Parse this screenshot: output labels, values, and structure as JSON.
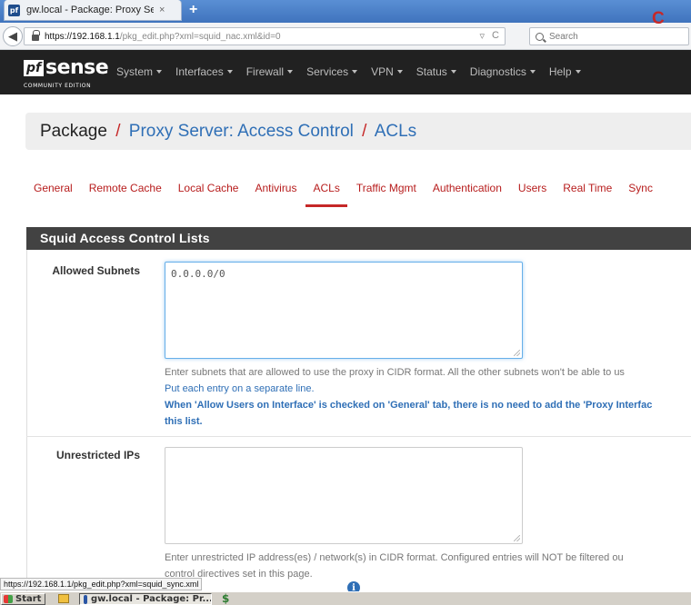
{
  "browser": {
    "tab_favicon": "pf",
    "tab_title": "gw.local - Package: Proxy Ser...",
    "tab_close": "×",
    "new_tab": "+",
    "url_host": "https://192.168.1.1",
    "url_path": "/pkg_edit.php?xml=squid_nac.xml&id=0",
    "url_dropdown": "▿",
    "url_reload": "C",
    "search_placeholder": "Search",
    "status_url": "https://192.168.1.1/pkg_edit.php?xml=squid_sync.xml"
  },
  "pfsense": {
    "logo_box": "pf",
    "logo_word": "sense",
    "edition": "COMMUNITY EDITION",
    "menu": [
      {
        "label": "System"
      },
      {
        "label": "Interfaces"
      },
      {
        "label": "Firewall"
      },
      {
        "label": "Services"
      },
      {
        "label": "VPN"
      },
      {
        "label": "Status"
      },
      {
        "label": "Diagnostics"
      },
      {
        "label": "Help"
      }
    ]
  },
  "breadcrumb": {
    "root": "Package",
    "sep1": "/",
    "item1": "Proxy Server: Access Control",
    "sep2": "/",
    "item2": "ACLs",
    "right_glyph": "C"
  },
  "subtabs": [
    {
      "label": "General",
      "active": false
    },
    {
      "label": "Remote Cache",
      "active": false
    },
    {
      "label": "Local Cache",
      "active": false
    },
    {
      "label": "Antivirus",
      "active": false
    },
    {
      "label": "ACLs",
      "active": true
    },
    {
      "label": "Traffic Mgmt",
      "active": false
    },
    {
      "label": "Authentication",
      "active": false
    },
    {
      "label": "Users",
      "active": false
    },
    {
      "label": "Real Time",
      "active": false
    },
    {
      "label": "Sync",
      "active": false
    }
  ],
  "panel": {
    "title": "Squid Access Control Lists",
    "allowed_subnets": {
      "label": "Allowed Subnets",
      "value": "0.0.0.0/0",
      "help1": "Enter subnets that are allowed to use the proxy in CIDR format. All the other subnets won't be able to us",
      "help2": "Put each entry on a separate line.",
      "help3": "When 'Allow Users on Interface' is checked on 'General' tab, there is no need to add the 'Proxy Interfac",
      "help4": "this list."
    },
    "unrestricted_ips": {
      "label": "Unrestricted IPs",
      "value": "",
      "help1": "Enter unrestricted IP address(es) / network(s) in CIDR format. Configured entries will NOT be filtered ou",
      "help2": "control directives set in this page."
    },
    "info_glyph": "i"
  },
  "taskbar": {
    "start": "Start",
    "task_title": "gw.local - Package: Pr...",
    "tray_icon": "$"
  },
  "colors": {
    "accent_red": "#c62828",
    "link_blue": "#2f6fb6",
    "nav_dark": "#212121",
    "panel_head": "#424242"
  }
}
